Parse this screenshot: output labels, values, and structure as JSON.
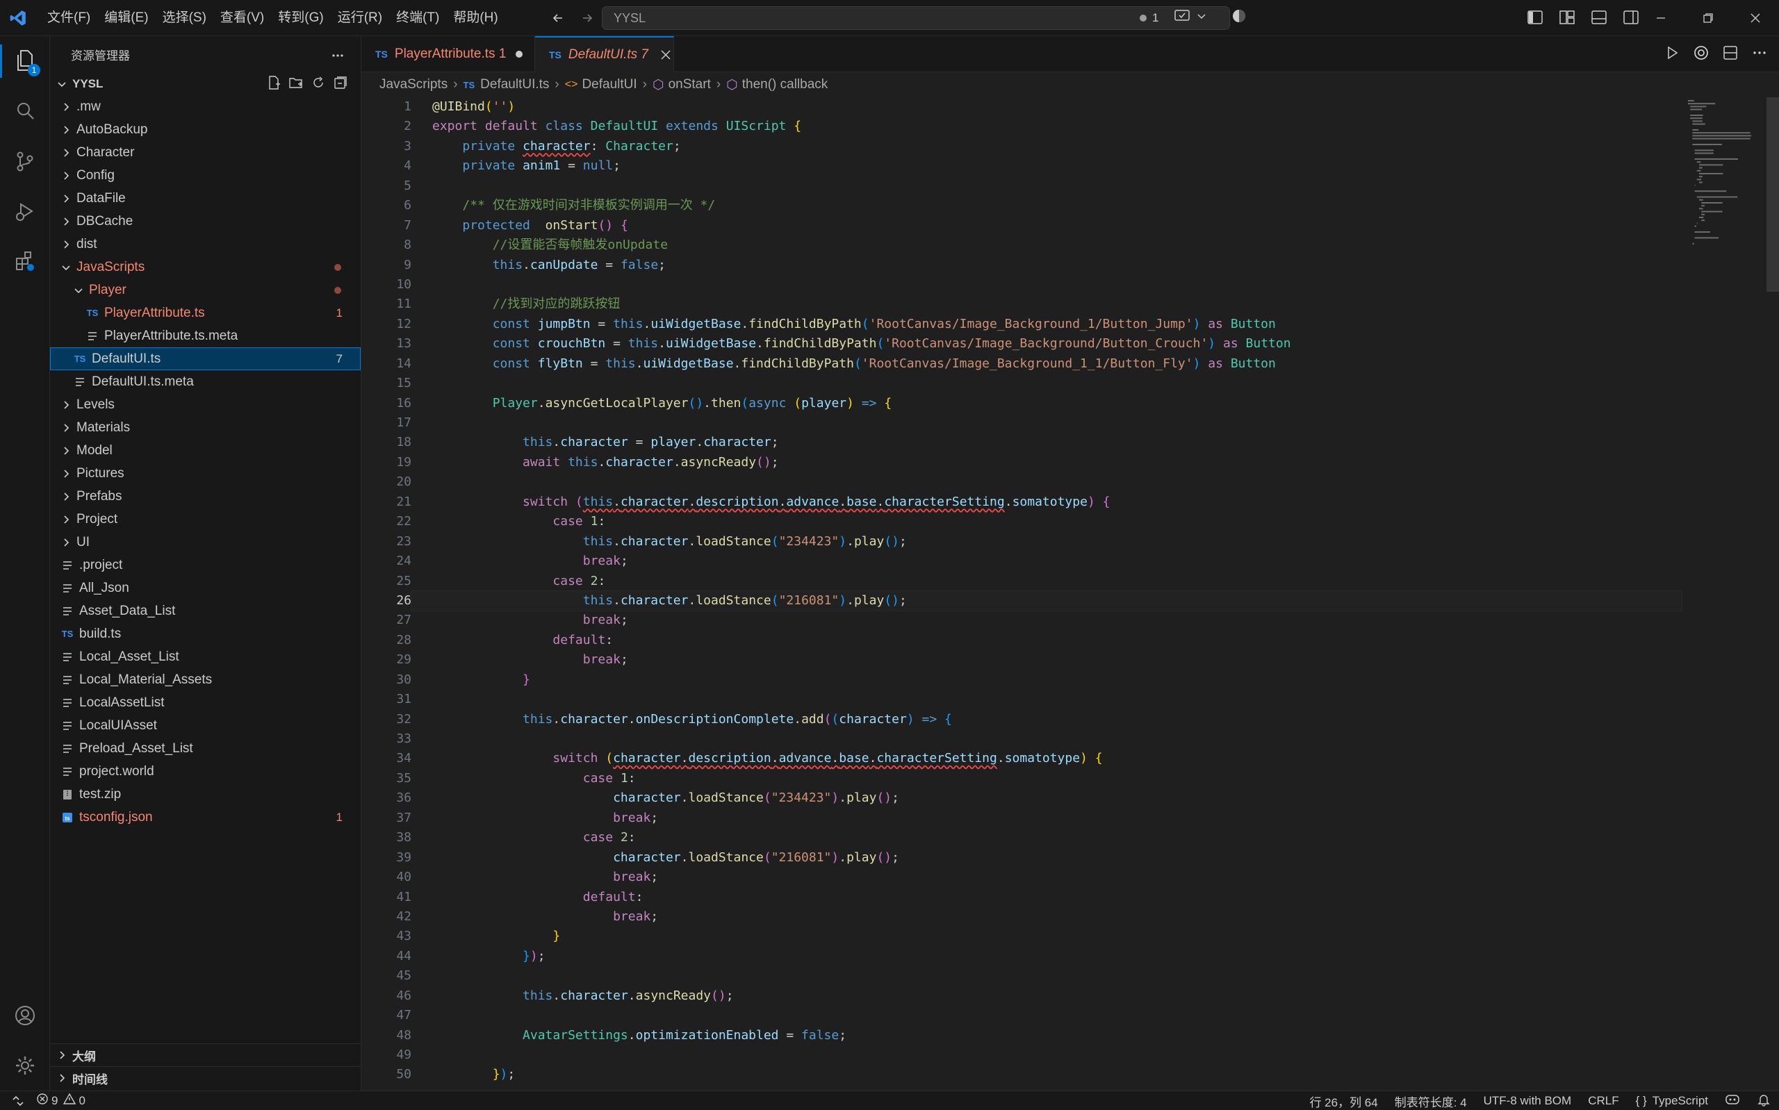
{
  "titlebar": {
    "menu": [
      "文件(F)",
      "编辑(E)",
      "选择(S)",
      "查看(V)",
      "转到(G)",
      "运行(R)",
      "终端(T)",
      "帮助(H)"
    ],
    "search_text": "YYSL",
    "notifications_count": "1"
  },
  "activity": {
    "explorer_badge": "1"
  },
  "sidebar": {
    "title": "资源管理器",
    "root": "YYSL",
    "tree": [
      {
        "label": ".mw",
        "type": "folder",
        "depth": 0
      },
      {
        "label": "AutoBackup",
        "type": "folder",
        "depth": 0
      },
      {
        "label": "Character",
        "type": "folder",
        "depth": 0
      },
      {
        "label": "Config",
        "type": "folder",
        "depth": 0
      },
      {
        "label": "DataFile",
        "type": "folder",
        "depth": 0
      },
      {
        "label": "DBCache",
        "type": "folder",
        "depth": 0
      },
      {
        "label": "dist",
        "type": "folder",
        "depth": 0
      },
      {
        "label": "JavaScripts",
        "type": "folder-open",
        "depth": 0,
        "modified": true
      },
      {
        "label": "Player",
        "type": "folder-open",
        "depth": 1,
        "modified": true
      },
      {
        "label": "PlayerAttribute.ts",
        "type": "ts",
        "depth": 2,
        "badge": "1",
        "modified": true
      },
      {
        "label": "PlayerAttribute.ts.meta",
        "type": "file",
        "depth": 2
      },
      {
        "label": "DefaultUI.ts",
        "type": "ts",
        "depth": 1,
        "badge": "7",
        "selected": true
      },
      {
        "label": "DefaultUI.ts.meta",
        "type": "file",
        "depth": 1
      },
      {
        "label": "Levels",
        "type": "folder",
        "depth": 0
      },
      {
        "label": "Materials",
        "type": "folder",
        "depth": 0
      },
      {
        "label": "Model",
        "type": "folder",
        "depth": 0
      },
      {
        "label": "Pictures",
        "type": "folder",
        "depth": 0
      },
      {
        "label": "Prefabs",
        "type": "folder",
        "depth": 0
      },
      {
        "label": "Project",
        "type": "folder",
        "depth": 0
      },
      {
        "label": "UI",
        "type": "folder",
        "depth": 0
      },
      {
        "label": ".project",
        "type": "file",
        "depth": 0
      },
      {
        "label": "All_Json",
        "type": "file",
        "depth": 0
      },
      {
        "label": "Asset_Data_List",
        "type": "file",
        "depth": 0
      },
      {
        "label": "build.ts",
        "type": "ts",
        "depth": 0
      },
      {
        "label": "Local_Asset_List",
        "type": "file",
        "depth": 0
      },
      {
        "label": "Local_Material_Assets",
        "type": "file",
        "depth": 0
      },
      {
        "label": "LocalAssetList",
        "type": "file",
        "depth": 0
      },
      {
        "label": "LocalUIAsset",
        "type": "file",
        "depth": 0
      },
      {
        "label": "Preload_Asset_List",
        "type": "file",
        "depth": 0
      },
      {
        "label": "project.world",
        "type": "file",
        "depth": 0
      },
      {
        "label": "test.zip",
        "type": "zip",
        "depth": 0
      },
      {
        "label": "tsconfig.json",
        "type": "tsjson",
        "depth": 0,
        "badge": "1",
        "modified": true
      }
    ],
    "outline_label": "大纲",
    "timeline_label": "时间线"
  },
  "tabs": [
    {
      "label": "PlayerAttribute.ts 1",
      "active": false
    },
    {
      "label": "DefaultUI.ts 7",
      "active": true
    }
  ],
  "breadcrumb": [
    "JavaScripts",
    "DefaultUI.ts",
    "DefaultUI",
    "onStart",
    "then() callback"
  ],
  "code": {
    "current_line": 26,
    "lines": [
      "<span class='f'>@UIBind</span><span class='p1'>(</span><span class='s'>''</span><span class='p1'>)</span>",
      "<span class='kc'>export</span> <span class='kc'>default</span> <span class='k'>class</span> <span class='cl'>DefaultUI</span> <span class='k'>extends</span> <span class='cl'>UIScript</span> <span class='p1'>{</span>",
      "    <span class='k'>private</span> <span class='v sq'>character</span>: <span class='cl'>Character</span>;",
      "    <span class='k'>private</span> <span class='v'>anim1</span> = <span class='k'>null</span>;",
      "",
      "    <span class='c'>/** 仅在游戏时间对非模板实例调用一次 */</span>",
      "    <span class='k'>protected</span>  <span class='f'>onStart</span><span class='p2'>()</span> <span class='p2'>{</span>",
      "        <span class='c'>//设置能否每帧触发onUpdate</span>",
      "        <span class='k'>this</span>.<span class='v'>canUpdate</span> = <span class='k'>false</span>;",
      "",
      "        <span class='c'>//找到对应的跳跃按钮</span>",
      "        <span class='k'>const</span> <span class='v'>jumpBtn</span> = <span class='k'>this</span>.<span class='v'>uiWidgetBase</span>.<span class='f'>findChildByPath</span><span class='p3'>(</span><span class='s'>'RootCanvas/Image_Background_1/Button_Jump'</span><span class='p3'>)</span> <span class='kc'>as</span> <span class='cl'>Button</span>",
      "        <span class='k'>const</span> <span class='v'>crouchBtn</span> = <span class='k'>this</span>.<span class='v'>uiWidgetBase</span>.<span class='f'>findChildByPath</span><span class='p3'>(</span><span class='s'>'RootCanvas/Image_Background/Button_Crouch'</span><span class='p3'>)</span> <span class='kc'>as</span> <span class='cl'>Button</span>",
      "        <span class='k'>const</span> <span class='v'>flyBtn</span> = <span class='k'>this</span>.<span class='v'>uiWidgetBase</span>.<span class='f'>findChildByPath</span><span class='p3'>(</span><span class='s'>'RootCanvas/Image_Background_1_1/Button_Fly'</span><span class='p3'>)</span> <span class='kc'>as</span> <span class='cl'>Button</span>",
      "",
      "        <span class='cl'>Player</span>.<span class='f'>asyncGetLocalPlayer</span><span class='p3'>()</span>.<span class='f'>then</span><span class='p3'>(</span><span class='k'>async</span> <span class='p1'>(</span><span class='v'>player</span><span class='p1'>)</span> <span class='k'>=&gt;</span> <span class='p1'>{</span>",
      "",
      "            <span class='k'>this</span>.<span class='v'>character</span> = <span class='v'>player</span>.<span class='v'>character</span>;",
      "            <span class='kc'>await</span> <span class='k'>this</span>.<span class='v'>character</span>.<span class='f'>asyncReady</span><span class='p2'>()</span>;",
      "",
      "            <span class='kc'>switch</span> <span class='p2'>(</span><span class='k sq'>this</span><span class='sq'>.</span><span class='v sq'>character</span><span class='sq'>.</span><span class='v sq'>description</span><span class='sq'>.</span><span class='v sq'>advance</span><span class='sq'>.</span><span class='v sq'>base</span><span class='sq'>.</span><span class='v sq'>characterSetting</span>.<span class='v'>somatotype</span><span class='p2'>)</span> <span class='p2'>{</span>",
      "                <span class='kc'>case</span> <span class='n'>1</span>:",
      "                    <span class='k'>this</span>.<span class='v'>character</span>.<span class='f'>loadStance</span><span class='p3'>(</span><span class='s'>\"234423\"</span><span class='p3'>)</span>.<span class='f'>play</span><span class='p3'>()</span>;",
      "                    <span class='kc'>break</span>;",
      "                <span class='kc'>case</span> <span class='n'>2</span>:",
      "                    <span class='k'>this</span>.<span class='v'>character</span>.<span class='f'>loadStance</span><span class='p3'>(</span><span class='s'>\"216081\"</span><span class='p3'>)</span>.<span class='f'>play</span><span class='p3'>()</span>;",
      "                    <span class='kc'>break</span>;",
      "                <span class='kc'>default</span>:",
      "                    <span class='kc'>break</span>;",
      "            <span class='p2'>}</span>",
      "",
      "            <span class='k'>this</span>.<span class='v'>character</span>.<span class='v'>onDescriptionComplete</span>.<span class='f'>add</span><span class='p2'>(</span><span class='p3'>(</span><span class='v'>character</span><span class='p3'>)</span> <span class='k'>=&gt;</span> <span class='p3'>{</span>",
      "",
      "                <span class='kc'>switch</span> <span class='p1'>(</span><span class='v sq'>character</span><span class='sq'>.</span><span class='v sq'>description</span><span class='sq'>.</span><span class='v sq'>advance</span><span class='sq'>.</span><span class='v sq'>base</span><span class='sq'>.</span><span class='v sq'>characterSetting</span>.<span class='v'>somatotype</span><span class='p1'>)</span> <span class='p1'>{</span>",
      "                    <span class='kc'>case</span> <span class='n'>1</span>:",
      "                        <span class='v'>character</span>.<span class='f'>loadStance</span><span class='p2'>(</span><span class='s'>\"234423\"</span><span class='p2'>)</span>.<span class='f'>play</span><span class='p2'>()</span>;",
      "                        <span class='kc'>break</span>;",
      "                    <span class='kc'>case</span> <span class='n'>2</span>:",
      "                        <span class='v'>character</span>.<span class='f'>loadStance</span><span class='p2'>(</span><span class='s'>\"216081\"</span><span class='p2'>)</span>.<span class='f'>play</span><span class='p2'>()</span>;",
      "                        <span class='kc'>break</span>;",
      "                    <span class='kc'>default</span>:",
      "                        <span class='kc'>break</span>;",
      "                <span class='p1'>}</span>",
      "            <span class='p3'>}</span><span class='p2'>)</span>;",
      "",
      "            <span class='k'>this</span>.<span class='v'>character</span>.<span class='f'>asyncReady</span><span class='p2'>()</span>;",
      "",
      "            <span class='cl'>AvatarSettings</span>.<span class='v'>optimizationEnabled</span> = <span class='k'>false</span>;",
      "",
      "        <span class='p1'>}</span><span class='p3'>)</span>;"
    ]
  },
  "statusbar": {
    "errors": "9",
    "warnings": "0",
    "position": "行 26，列 64",
    "tab_size": "制表符长度: 4",
    "encoding": "UTF-8 with BOM",
    "eol": "CRLF",
    "language": "TypeScript"
  },
  "colors": {
    "accent": "#0078d4",
    "modified": "#f48771",
    "background": "#1f1f1f"
  }
}
